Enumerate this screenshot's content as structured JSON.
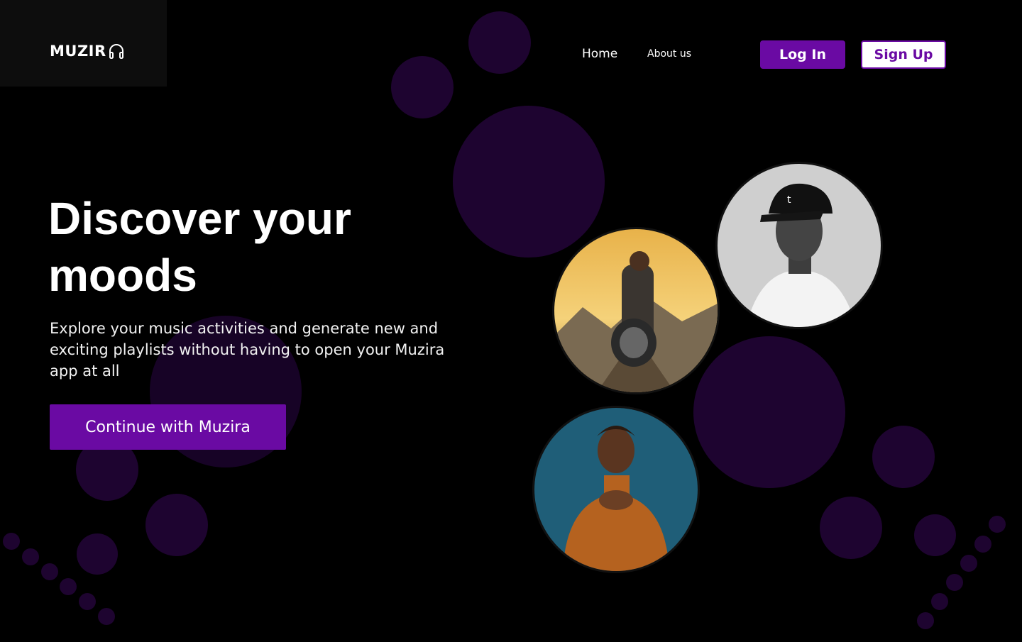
{
  "brand": {
    "name": "MUZIR",
    "icon": "headphones-icon"
  },
  "nav": {
    "home": "Home",
    "about": "About us",
    "login": "Log In",
    "signup": "Sign Up"
  },
  "hero": {
    "title": "Discover your moods",
    "subtitle": "Explore your music activities and generate  new and exciting playlists without having to open your Muzira app at all",
    "cta": "Continue with Muzira"
  },
  "artists": [
    {
      "icon": "album-art-image"
    },
    {
      "icon": "artist-portrait-image"
    },
    {
      "icon": "artist-portrait-image"
    }
  ],
  "colors": {
    "accent": "#6a0aa3",
    "background": "#000000",
    "bubble": "#1e0430"
  }
}
